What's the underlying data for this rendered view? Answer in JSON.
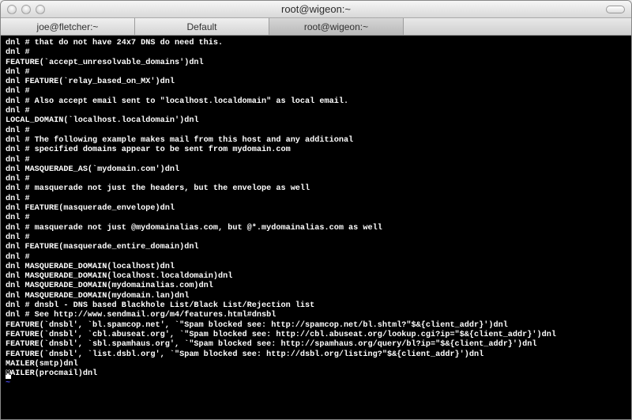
{
  "titlebar": {
    "title": "root@wigeon:~"
  },
  "tabs": [
    {
      "label": "joe@fletcher:~",
      "active": false
    },
    {
      "label": "Default",
      "active": false
    },
    {
      "label": "root@wigeon:~",
      "active": true
    }
  ],
  "terminal_lines": [
    "dnl # that do not have 24x7 DNS do need this.",
    "dnl #",
    "FEATURE(`accept_unresolvable_domains')dnl",
    "dnl #",
    "dnl FEATURE(`relay_based_on_MX')dnl",
    "dnl #",
    "dnl # Also accept email sent to \"localhost.localdomain\" as local email.",
    "dnl #",
    "LOCAL_DOMAIN(`localhost.localdomain')dnl",
    "dnl #",
    "dnl # The following example makes mail from this host and any additional",
    "dnl # specified domains appear to be sent from mydomain.com",
    "dnl #",
    "dnl MASQUERADE_AS(`mydomain.com')dnl",
    "dnl #",
    "dnl # masquerade not just the headers, but the envelope as well",
    "dnl #",
    "dnl FEATURE(masquerade_envelope)dnl",
    "dnl #",
    "dnl # masquerade not just @mydomainalias.com, but @*.mydomainalias.com as well",
    "dnl #",
    "dnl FEATURE(masquerade_entire_domain)dnl",
    "dnl #",
    "dnl MASQUERADE_DOMAIN(localhost)dnl",
    "dnl MASQUERADE_DOMAIN(localhost.localdomain)dnl",
    "dnl MASQUERADE_DOMAIN(mydomainalias.com)dnl",
    "dnl MASQUERADE_DOMAIN(mydomain.lan)dnl",
    "dnl # dnsbl - DNS based Blackhole List/Black List/Rejection list",
    "dnl # See http://www.sendmail.org/m4/features.html#dnsbl",
    "FEATURE(`dnsbl', `bl.spamcop.net', `\"Spam blocked see: http://spamcop.net/bl.shtml?\"$&{client_addr}')dnl",
    "FEATURE(`dnsbl', `cbl.abuseat.org', `\"Spam blocked see: http://cbl.abuseat.org/lookup.cgi?ip=\"$&{client_addr}')dnl",
    "FEATURE(`dnsbl', `sbl.spamhaus.org', `\"Spam blocked see: http://spamhaus.org/query/bl?ip=\"$&{client_addr}')dnl",
    "FEATURE(`dnsbl', `list.dsbl.org', `\"Spam blocked see: http://dsbl.org/listing?\"$&{client_addr}')dnl",
    "MAILER(smtp)dnl"
  ],
  "cursor_line_prefix": "M",
  "cursor_line_suffix": "AILER(procmail)dnl",
  "tilde": "~"
}
